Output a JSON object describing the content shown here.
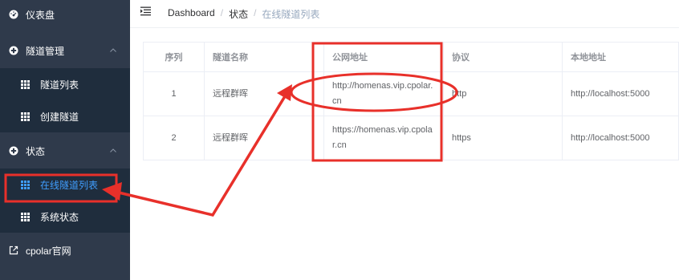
{
  "sidebar": {
    "dashboard": "仪表盘",
    "tunnel_mgmt": "隧道管理",
    "tunnel_list": "隧道列表",
    "create_tunnel": "创建隧道",
    "status": "状态",
    "online_tunnels": "在线隧道列表",
    "system_status": "系统状态",
    "cpolar_site": "cpolar官网"
  },
  "breadcrumb": {
    "home": "Dashboard",
    "sep": "/",
    "section": "状态",
    "current": "在线隧道列表"
  },
  "table": {
    "headers": [
      "序列",
      "隧道名称",
      "公网地址",
      "协议",
      "本地地址"
    ],
    "rows": [
      {
        "idx": "1",
        "name": "远程群晖",
        "url": "http://homenas.vip.cpolar.cn",
        "proto": "http",
        "local": "http://localhost:5000"
      },
      {
        "idx": "2",
        "name": "远程群晖",
        "url": "https://homenas.vip.cpolar.cn",
        "proto": "https",
        "local": "http://localhost:5000"
      }
    ]
  },
  "colors": {
    "sidebar_bg": "#2f3a4b",
    "submenu_bg": "#1f2d3d",
    "active_text": "#409eff",
    "annotation_red": "#e8302a"
  }
}
